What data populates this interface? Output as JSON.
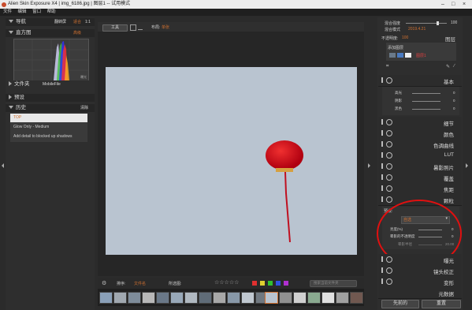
{
  "window": {
    "title": "Alien Skin Exposure X4 | img_6186.jpg | 图层1 -- 试用模式"
  },
  "menu": [
    "文件",
    "编辑",
    "窗口",
    "帮助"
  ],
  "left": {
    "nav_label": "导航",
    "nav_opts": [
      "翻转屏",
      "适合",
      "1:1"
    ],
    "histogram_label": "直方图",
    "histogram_mode": "高级",
    "histogram_tag": "曝光",
    "folder_label": "文件夹",
    "folder_value": "MobileFile",
    "preset_label": "预设",
    "history_label": "历史",
    "history_clear": "清除",
    "history_items": [
      "TOP",
      "Glow Only - Medium",
      "Add detail to blocked up shadows"
    ]
  },
  "center": {
    "tool_btn": "工具",
    "scale_label": "布局:",
    "scale_value": "单张",
    "filter_label": "排序:",
    "filter_value": "文件名",
    "select_label": "所选图:",
    "search_placeholder": "搜索当前文件夹"
  },
  "right": {
    "opacity_label": "混合强度",
    "opacity_value": "100",
    "blend_label": "混合模式",
    "blend_value": "2019.4.21",
    "layer_opacity_label": "不透明度:",
    "layer_opacity_value": "100",
    "layers_label": "图层",
    "add_layer": "添加图层",
    "layer_name": "图层1",
    "basic_label": "基本",
    "basic_rows": [
      {
        "label": "高光",
        "value": "0"
      },
      {
        "label": "阴影",
        "value": "0"
      },
      {
        "label": "黑色",
        "value": "0"
      }
    ],
    "panels": [
      "细节",
      "颜色",
      "色调曲线",
      "LUT",
      "暑影照片",
      "覆盖",
      "焦距",
      "颗粒"
    ],
    "glow": {
      "preset_label": "预设:",
      "preset_value": "自选",
      "rows": [
        {
          "label": "亮度(%)",
          "value": "0"
        },
        {
          "label": "晕影的不透明度",
          "value": "0"
        },
        {
          "label": "晕影半径",
          "value": "20.00"
        }
      ]
    },
    "panels2": [
      "曝光",
      "镜头校正",
      "变形",
      "元数据"
    ],
    "prev_btn": "先前的",
    "reset_btn": "重置"
  }
}
